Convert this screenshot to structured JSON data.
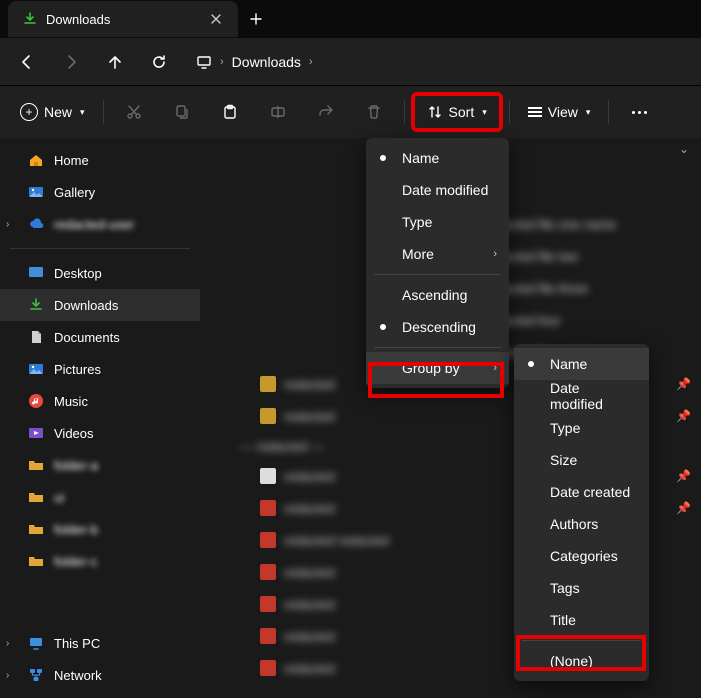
{
  "tab": {
    "title": "Downloads"
  },
  "breadcrumb": {
    "current": "Downloads"
  },
  "toolbar": {
    "new": "New",
    "sort": "Sort",
    "view": "View"
  },
  "sidebar": {
    "home": "Home",
    "gallery": "Gallery",
    "userfolder": "redacted-user",
    "desktop": "Desktop",
    "downloads": "Downloads",
    "documents": "Documents",
    "pictures": "Pictures",
    "music": "Music",
    "videos": "Videos",
    "pinned": [
      "folder-a",
      "ui",
      "folder-b",
      "folder-c"
    ],
    "thispc": "This PC",
    "network": "Network"
  },
  "sort_menu": {
    "name": "Name",
    "date_modified": "Date modified",
    "type": "Type",
    "more": "More",
    "ascending": "Ascending",
    "descending": "Descending",
    "group_by": "Group by"
  },
  "groupby_menu": {
    "name": "Name",
    "date_modified": "Date modified",
    "type": "Type",
    "size": "Size",
    "date_created": "Date created",
    "authors": "Authors",
    "categories": "Categories",
    "tags": "Tags",
    "title": "Title",
    "none": "(None)"
  },
  "highlights": {
    "sort_button": true,
    "group_by_item": true,
    "none_item": true
  }
}
